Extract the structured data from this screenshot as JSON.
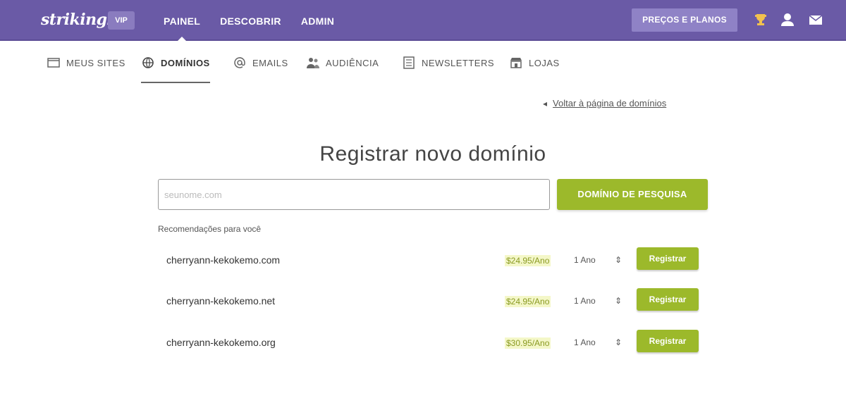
{
  "header": {
    "logo": "strikingly",
    "badge": "VIP",
    "nav": [
      {
        "label": "PAINEL",
        "active": true
      },
      {
        "label": "DESCOBRIR",
        "active": false
      },
      {
        "label": "ADMIN",
        "active": false
      }
    ],
    "pricing_button": "PREÇOS E PLANOS",
    "icons": [
      "trophy-icon",
      "user-icon",
      "mail-icon"
    ]
  },
  "subnav": {
    "items": [
      {
        "label": "MEUS SITES",
        "icon": "browser-icon",
        "active": false
      },
      {
        "label": "DOMÍNIOS",
        "icon": "globe-icon",
        "active": true
      },
      {
        "label": "EMAILS",
        "icon": "at-icon",
        "active": false
      },
      {
        "label": "AUDIÊNCIA",
        "icon": "people-icon",
        "active": false
      },
      {
        "label": "NEWSLETTERS",
        "icon": "newsletter-icon",
        "active": false
      },
      {
        "label": "LOJAS",
        "icon": "store-icon",
        "active": false
      }
    ]
  },
  "back_link": {
    "arrow": "◂",
    "label": "Voltar à página de domínios"
  },
  "main": {
    "title": "Registrar novo domínio",
    "search": {
      "placeholder": "seunome.com",
      "value": "",
      "button": "DOMÍNIO DE PESQUISA"
    },
    "recommendations_label": "Recomendações para você",
    "results": [
      {
        "domain": "cherryann-kekokemo.com",
        "price": "$24.95/Ano",
        "years": "1 Ano",
        "stepper": "⇕",
        "button": "Registrar"
      },
      {
        "domain": "cherryann-kekokemo.net",
        "price": "$24.95/Ano",
        "years": "1 Ano",
        "stepper": "⇕",
        "button": "Registrar"
      },
      {
        "domain": "cherryann-kekokemo.org",
        "price": "$30.95/Ano",
        "years": "1 Ano",
        "stepper": "⇕",
        "button": "Registrar"
      }
    ]
  },
  "colors": {
    "header_bg": "#6a5aa6",
    "accent_green": "#9cb92b",
    "pricing_bg": "#8f82c6"
  }
}
